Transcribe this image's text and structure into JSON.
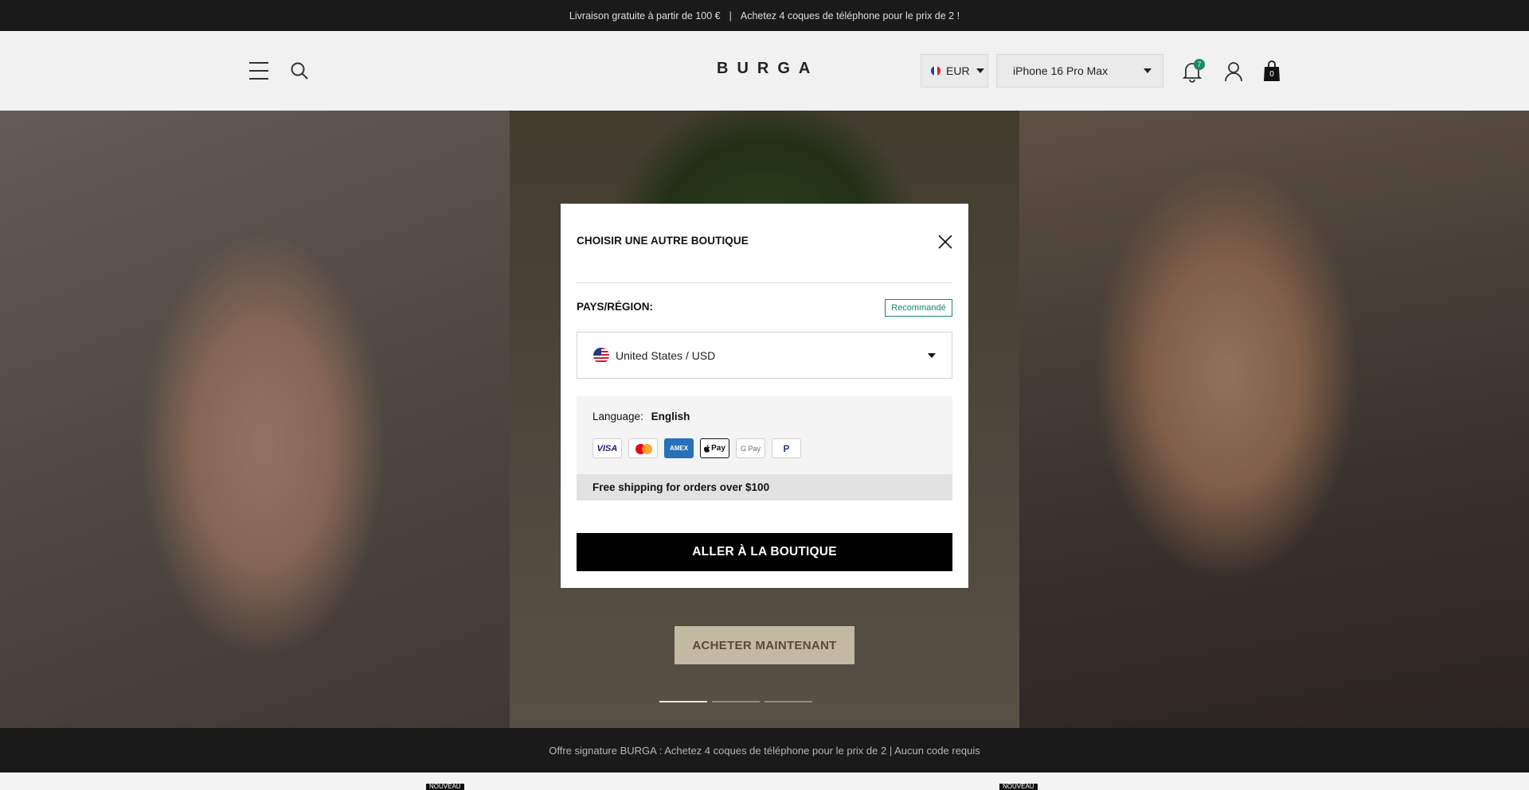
{
  "announcement": {
    "left": "Livraison gratuite à partir de 100 €",
    "separator": "|",
    "right": "Achetez 4 coques de téléphone pour le prix de 2 !"
  },
  "header": {
    "logo": "BURGA",
    "currency": "EUR",
    "model_select": "iPhone 16 Pro Max",
    "notification_count": "7",
    "cart_count": "0"
  },
  "hero": {
    "cta_label": "ACHETER MAINTENANT",
    "slides": 3,
    "active_slide": 1
  },
  "bottom_bar": {
    "text": "Offre signature BURGA : Achetez 4 coques de téléphone pour le prix de 2 | Aucun code requis"
  },
  "below_fold": {
    "badges": [
      "NOUVEAU",
      "NOUVEAU"
    ]
  },
  "modal": {
    "title": "CHOISIR UNE AUTRE BOUTIQUE",
    "region_label": "PAYS/RÉGION:",
    "recommended_badge": "Recommandé",
    "selected_country": "United States / USD",
    "language_label": "Language:",
    "language_value": "English",
    "payment_methods": [
      "VISA",
      "Mastercard",
      "AMEX",
      "Pay",
      "G Pay",
      "P"
    ],
    "shipping_note": "Free shipping for orders over $100",
    "go_button": "ALLER À LA BOUTIQUE"
  },
  "colors": {
    "accent_green": "#16896a",
    "dark_bar": "#1a1a1a",
    "button_black": "#000000"
  }
}
